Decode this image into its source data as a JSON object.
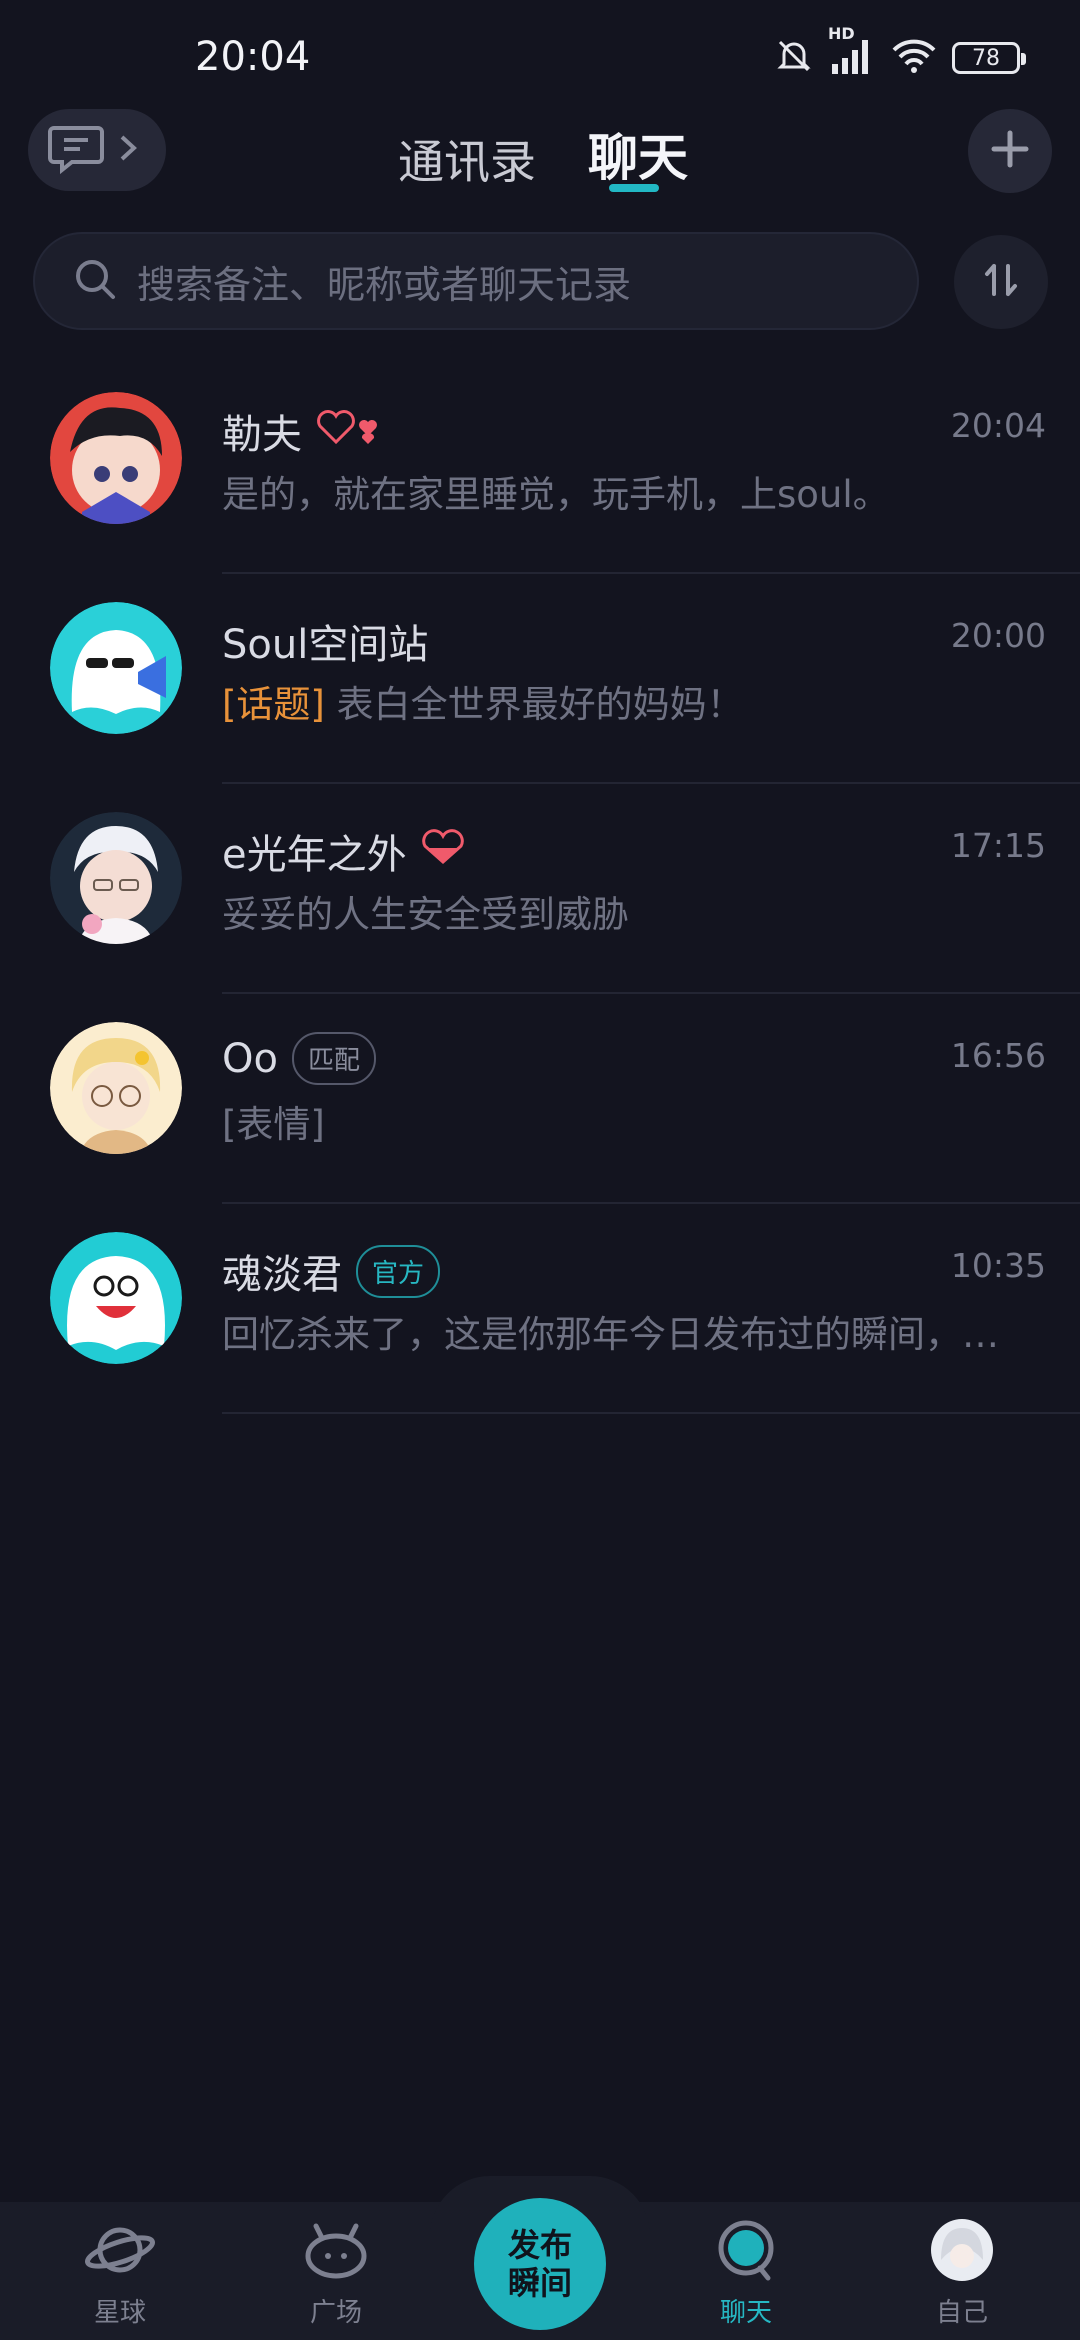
{
  "status_bar": {
    "time": "20:04",
    "network_label": "HD",
    "battery": "78"
  },
  "header": {
    "tabs": [
      {
        "label": "通讯录",
        "active": false
      },
      {
        "label": "聊天",
        "active": true
      }
    ],
    "accent_color": "#22b8c4"
  },
  "search": {
    "placeholder": "搜索备注、昵称或者聊天记录"
  },
  "chats": [
    {
      "name": "勒夫",
      "time": "20:04",
      "preview": "是的，就在家里睡觉，玩手机，上soul。",
      "icon": "heart-outline-icon"
    },
    {
      "name": "Soul空间站",
      "time": "20:00",
      "tag": "[话题]",
      "preview": " 表白全世界最好的妈妈！"
    },
    {
      "name": "e光年之外",
      "time": "17:15",
      "preview": "妥妥的人生安全受到威胁",
      "icon": "heart-half-icon"
    },
    {
      "name": "Oo",
      "time": "16:56",
      "badge": "匹配",
      "preview": "[表情]"
    },
    {
      "name": "魂淡君",
      "time": "10:35",
      "badge": "官方",
      "preview": "回忆杀来了，这是你那年今日发布过的瞬间，…"
    }
  ],
  "bottom_nav": {
    "items": [
      {
        "label": "星球",
        "icon": "planet-icon"
      },
      {
        "label": "广场",
        "icon": "square-icon"
      },
      {
        "label": "聊天",
        "icon": "chat-icon",
        "active": true
      },
      {
        "label": "自己",
        "icon": "avatar"
      }
    ],
    "publish_line1": "发布",
    "publish_line2": "瞬间"
  }
}
